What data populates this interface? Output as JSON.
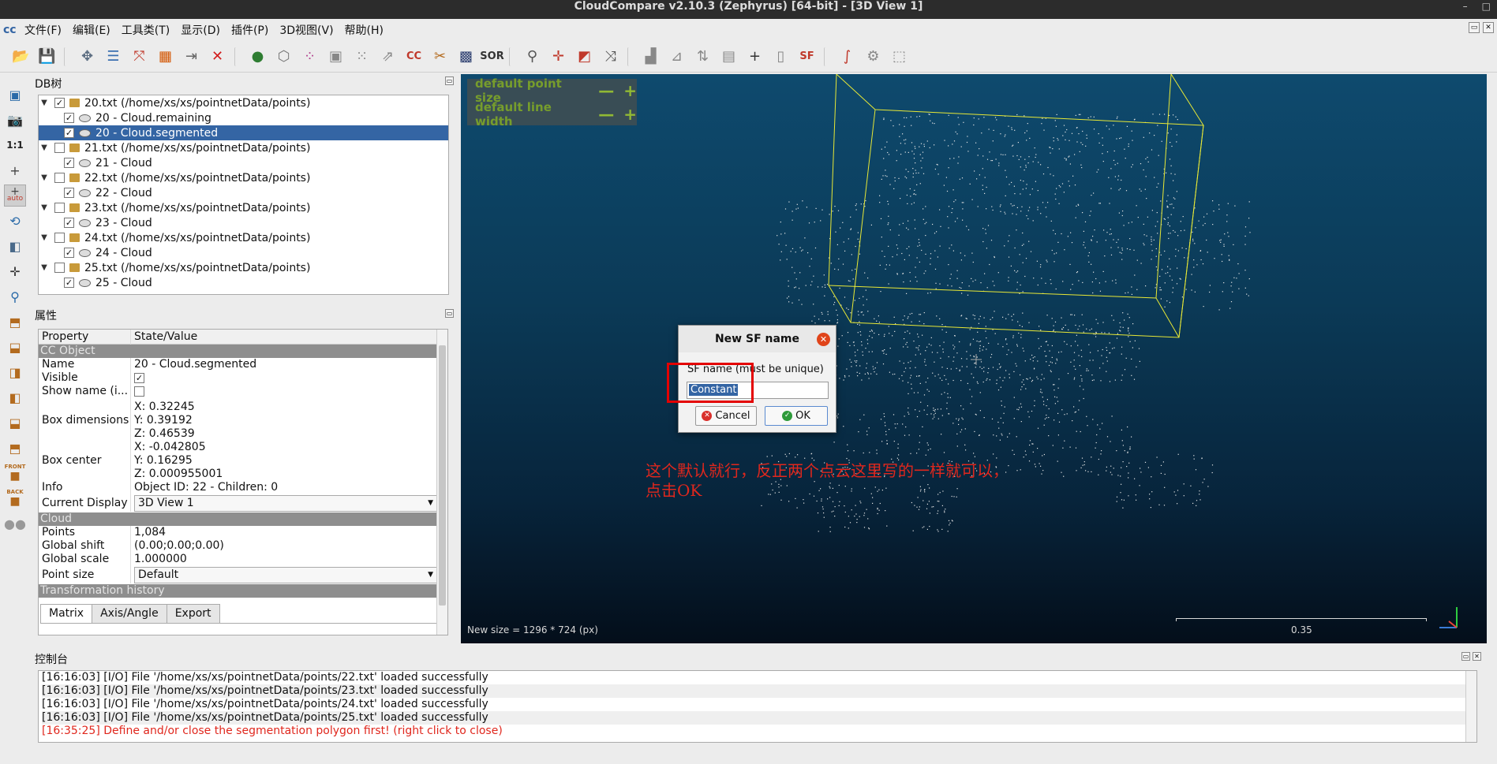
{
  "window": {
    "title": "CloudCompare v2.10.3 (Zephyrus) [64-bit] - [3D View 1]"
  },
  "menu": [
    "文件(F)",
    "编辑(E)",
    "工具类(T)",
    "显示(D)",
    "插件(P)",
    "3D视图(V)",
    "帮助(H)"
  ],
  "toolbar": {
    "sor_label": "SOR",
    "cc_label": "CC",
    "sf_label": "SF"
  },
  "left_tools": {
    "scale_label": "1:1",
    "auto_label": "auto",
    "front_label": "FRONT",
    "back_label": "BACK"
  },
  "db_tree": {
    "title": "DB树",
    "items": [
      {
        "label": "20.txt (/home/xs/xs/pointnetData/points)",
        "type": "file",
        "level": 0,
        "checked": true
      },
      {
        "label": "20 - Cloud.remaining",
        "type": "cloud",
        "level": 1,
        "checked": true
      },
      {
        "label": "20 - Cloud.segmented",
        "type": "cloud",
        "level": 1,
        "checked": true,
        "selected": true
      },
      {
        "label": "21.txt (/home/xs/xs/pointnetData/points)",
        "type": "file",
        "level": 0,
        "checked": false
      },
      {
        "label": "21 - Cloud",
        "type": "cloud",
        "level": 1,
        "checked": true
      },
      {
        "label": "22.txt (/home/xs/xs/pointnetData/points)",
        "type": "file",
        "level": 0,
        "checked": false
      },
      {
        "label": "22 - Cloud",
        "type": "cloud",
        "level": 1,
        "checked": true
      },
      {
        "label": "23.txt (/home/xs/xs/pointnetData/points)",
        "type": "file",
        "level": 0,
        "checked": false
      },
      {
        "label": "23 - Cloud",
        "type": "cloud",
        "level": 1,
        "checked": true
      },
      {
        "label": "24.txt (/home/xs/xs/pointnetData/points)",
        "type": "file",
        "level": 0,
        "checked": false
      },
      {
        "label": "24 - Cloud",
        "type": "cloud",
        "level": 1,
        "checked": true
      },
      {
        "label": "25.txt (/home/xs/xs/pointnetData/points)",
        "type": "file",
        "level": 0,
        "checked": false
      },
      {
        "label": "25 - Cloud",
        "type": "cloud",
        "level": 1,
        "checked": true
      }
    ]
  },
  "properties": {
    "title": "属性",
    "col_property": "Property",
    "col_value": "State/Value",
    "section_ccobject": "CC Object",
    "name_key": "Name",
    "name_val": "20 - Cloud.segmented",
    "visible_key": "Visible",
    "showname_key": "Show name (i...",
    "boxdim_key": "Box dimensions",
    "boxdim_x": "X: 0.32245",
    "boxdim_y": "Y: 0.39192",
    "boxdim_z": "Z: 0.46539",
    "boxcenter_key": "Box center",
    "boxcenter_x": "X: -0.042805",
    "boxcenter_y": "Y: 0.16295",
    "boxcenter_z": "Z: 0.000955001",
    "info_key": "Info",
    "info_val": "Object ID: 22 - Children: 0",
    "display_key": "Current Display",
    "display_val": "3D View 1",
    "section_cloud": "Cloud",
    "points_key": "Points",
    "points_val": "1,084",
    "shift_key": "Global shift",
    "shift_val": "(0.00;0.00;0.00)",
    "scale_key": "Global scale",
    "scale_val": "1.000000",
    "psize_key": "Point size",
    "psize_val": "Default",
    "section_transform": "Transformation history",
    "tabs": [
      "Matrix",
      "Axis/Angle",
      "Export"
    ]
  },
  "view3d": {
    "point_size_label": "default point size",
    "line_width_label": "default line width",
    "minus": "—",
    "plus": "+",
    "new_size": "New size = 1296 * 724 (px)",
    "scale_value": "0.35"
  },
  "dialog": {
    "title": "New SF name",
    "label": "SF name (must be unique)",
    "input_value": "Constant",
    "cancel_label": "Cancel",
    "ok_label": "OK"
  },
  "annotation": {
    "line1": "这个默认就行，反正两个点云这里写的一样就可以，",
    "line2": "点击OK"
  },
  "console": {
    "title": "控制台",
    "lines": [
      {
        "text": "[16:16:03] [I/O] File '/home/xs/xs/pointnetData/points/22.txt' loaded successfully",
        "error": false
      },
      {
        "text": "[16:16:03] [I/O] File '/home/xs/xs/pointnetData/points/23.txt' loaded successfully",
        "error": false
      },
      {
        "text": "[16:16:03] [I/O] File '/home/xs/xs/pointnetData/points/24.txt' loaded successfully",
        "error": false
      },
      {
        "text": "[16:16:03] [I/O] File '/home/xs/xs/pointnetData/points/25.txt' loaded successfully",
        "error": false
      },
      {
        "text": "[16:35:25] Define and/or close the segmentation polygon first! (right click to close)",
        "error": true
      }
    ]
  },
  "colors": {
    "accent": "#3465a4",
    "error": "#e0271d",
    "overlay_text": "#7fa428",
    "bbox": "#e8e836",
    "view_top": "#0e4a6e",
    "view_bottom": "#040e1a"
  }
}
